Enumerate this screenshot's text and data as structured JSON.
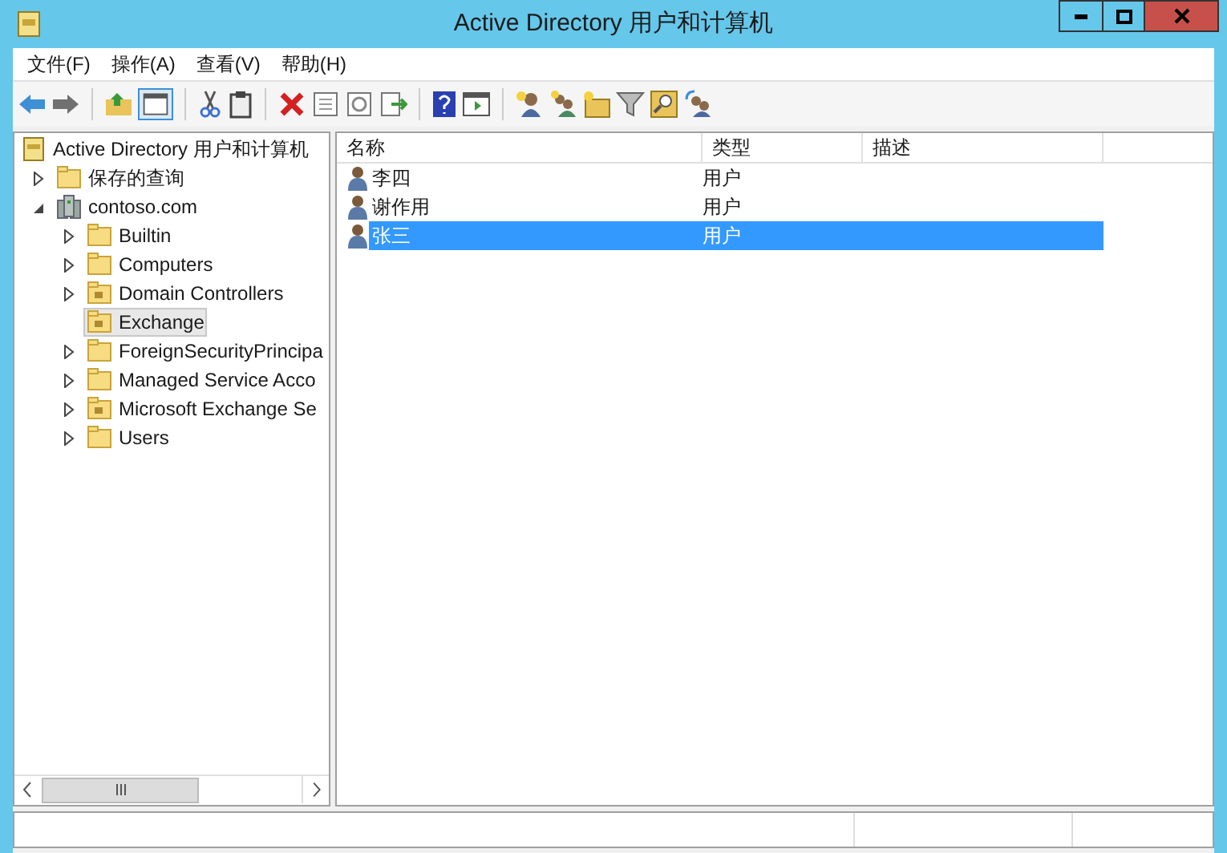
{
  "window": {
    "title": "Active Directory 用户和计算机"
  },
  "menu": [
    "文件(F)",
    "操作(A)",
    "查看(V)",
    "帮助(H)"
  ],
  "tree": [
    {
      "label": "Active Directory 用户和计算机",
      "kind": "root",
      "selected": false,
      "children": [
        {
          "label": "保存的查询",
          "kind": "folder",
          "expanded": false,
          "selected": false
        },
        {
          "label": "contoso.com",
          "kind": "domain",
          "expanded": true,
          "selected": false,
          "children": [
            {
              "label": "Builtin",
              "kind": "folder",
              "expanded": false,
              "selected": false
            },
            {
              "label": "Computers",
              "kind": "folder",
              "expanded": false,
              "selected": false
            },
            {
              "label": "Domain Controllers",
              "kind": "ou",
              "expanded": false,
              "selected": false
            },
            {
              "label": "Exchange",
              "kind": "ou",
              "selected": true
            },
            {
              "label": "ForeignSecurityPrincipa",
              "kind": "folder",
              "expanded": false,
              "selected": false
            },
            {
              "label": "Managed Service Acco",
              "kind": "folder",
              "expanded": false,
              "selected": false
            },
            {
              "label": "Microsoft Exchange Se",
              "kind": "ou",
              "expanded": false,
              "selected": false
            },
            {
              "label": "Users",
              "kind": "folder",
              "expanded": false,
              "selected": false
            }
          ]
        }
      ]
    }
  ],
  "list": {
    "columns": [
      "名称",
      "类型",
      "描述"
    ],
    "rows": [
      {
        "name": "李四",
        "type": "用户",
        "selected": false
      },
      {
        "name": "谢作用",
        "type": "用户",
        "selected": false
      },
      {
        "name": "张三",
        "type": "用户",
        "selected": true
      }
    ]
  }
}
